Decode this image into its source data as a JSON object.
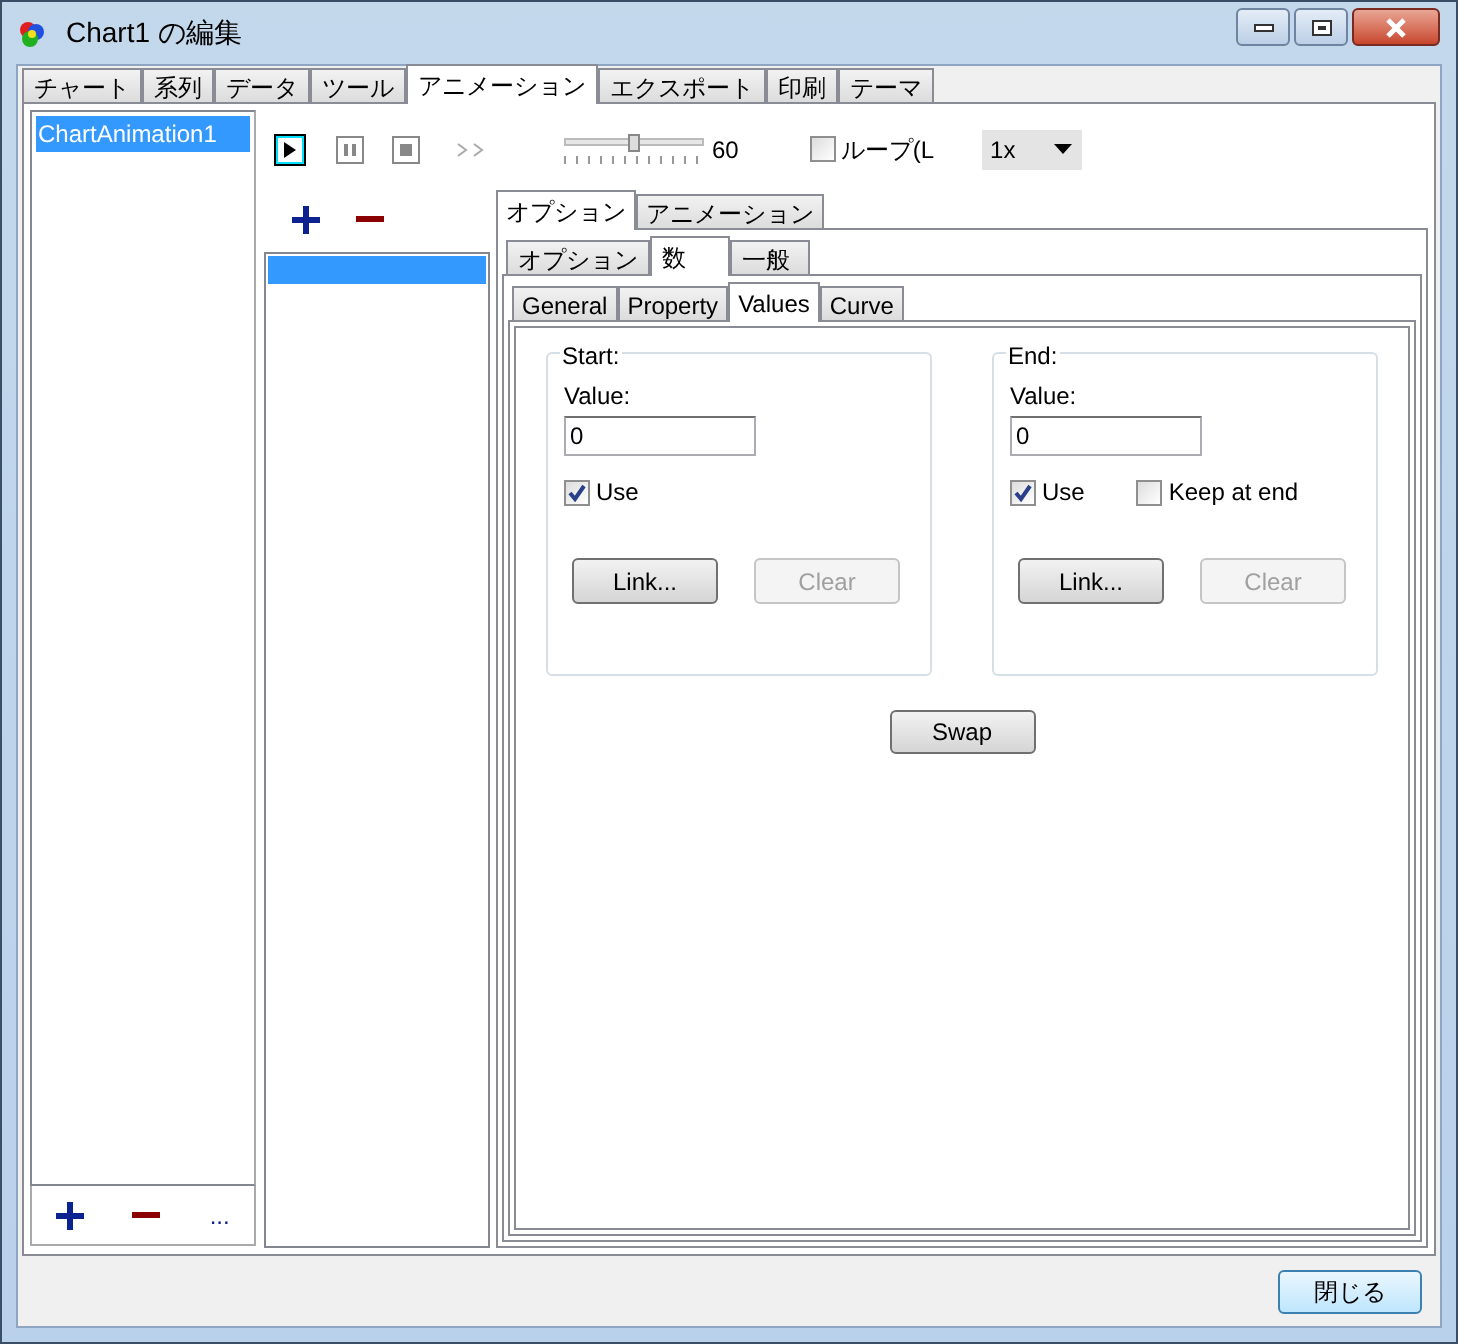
{
  "window": {
    "title": "Chart1 の編集"
  },
  "tabs": [
    {
      "label": "チャート",
      "selected": false
    },
    {
      "label": "系列",
      "selected": false
    },
    {
      "label": "データ",
      "selected": false
    },
    {
      "label": "ツール",
      "selected": false
    },
    {
      "label": "アニメーション",
      "selected": true
    },
    {
      "label": "エクスポート",
      "selected": false
    },
    {
      "label": "印刷",
      "selected": false
    },
    {
      "label": "テーマ",
      "selected": false
    }
  ],
  "animations": {
    "items": [
      {
        "label": "ChartAnimation1",
        "selected": true
      }
    ],
    "more": "..."
  },
  "player": {
    "speed_reading": "60",
    "speed": {
      "level": 0.5
    },
    "loop": {
      "label": "ループ(L",
      "checked": false
    },
    "rate": "1x"
  },
  "steps": [
    {
      "selected": true
    }
  ],
  "outer_tabs": [
    {
      "label": "オプション",
      "selected": true
    },
    {
      "label": "アニメーション",
      "selected": false
    }
  ],
  "inner_tabs": [
    {
      "label": "オプション",
      "selected": false
    },
    {
      "label": "数",
      "selected": true
    },
    {
      "label": "一般",
      "selected": false
    }
  ],
  "value_tabs": [
    {
      "label": "General",
      "selected": false
    },
    {
      "label": "Property",
      "selected": false
    },
    {
      "label": "Values",
      "selected": true
    },
    {
      "label": "Curve",
      "selected": false
    }
  ],
  "groups": [
    {
      "title": "Start:",
      "value_label": "Value:",
      "value": "0",
      "options": [
        {
          "label": "Use",
          "checked": true
        }
      ],
      "link": "Link...",
      "clear": {
        "label": "Clear",
        "disabled": true
      }
    },
    {
      "title": "End:",
      "value_label": "Value:",
      "value": "0",
      "options": [
        {
          "label": "Use",
          "checked": true
        },
        {
          "label": "Keep at end",
          "checked": false
        }
      ],
      "link": "Link...",
      "clear": {
        "label": "Clear",
        "disabled": true
      }
    }
  ],
  "swap": "Swap",
  "close": "閉じる"
}
